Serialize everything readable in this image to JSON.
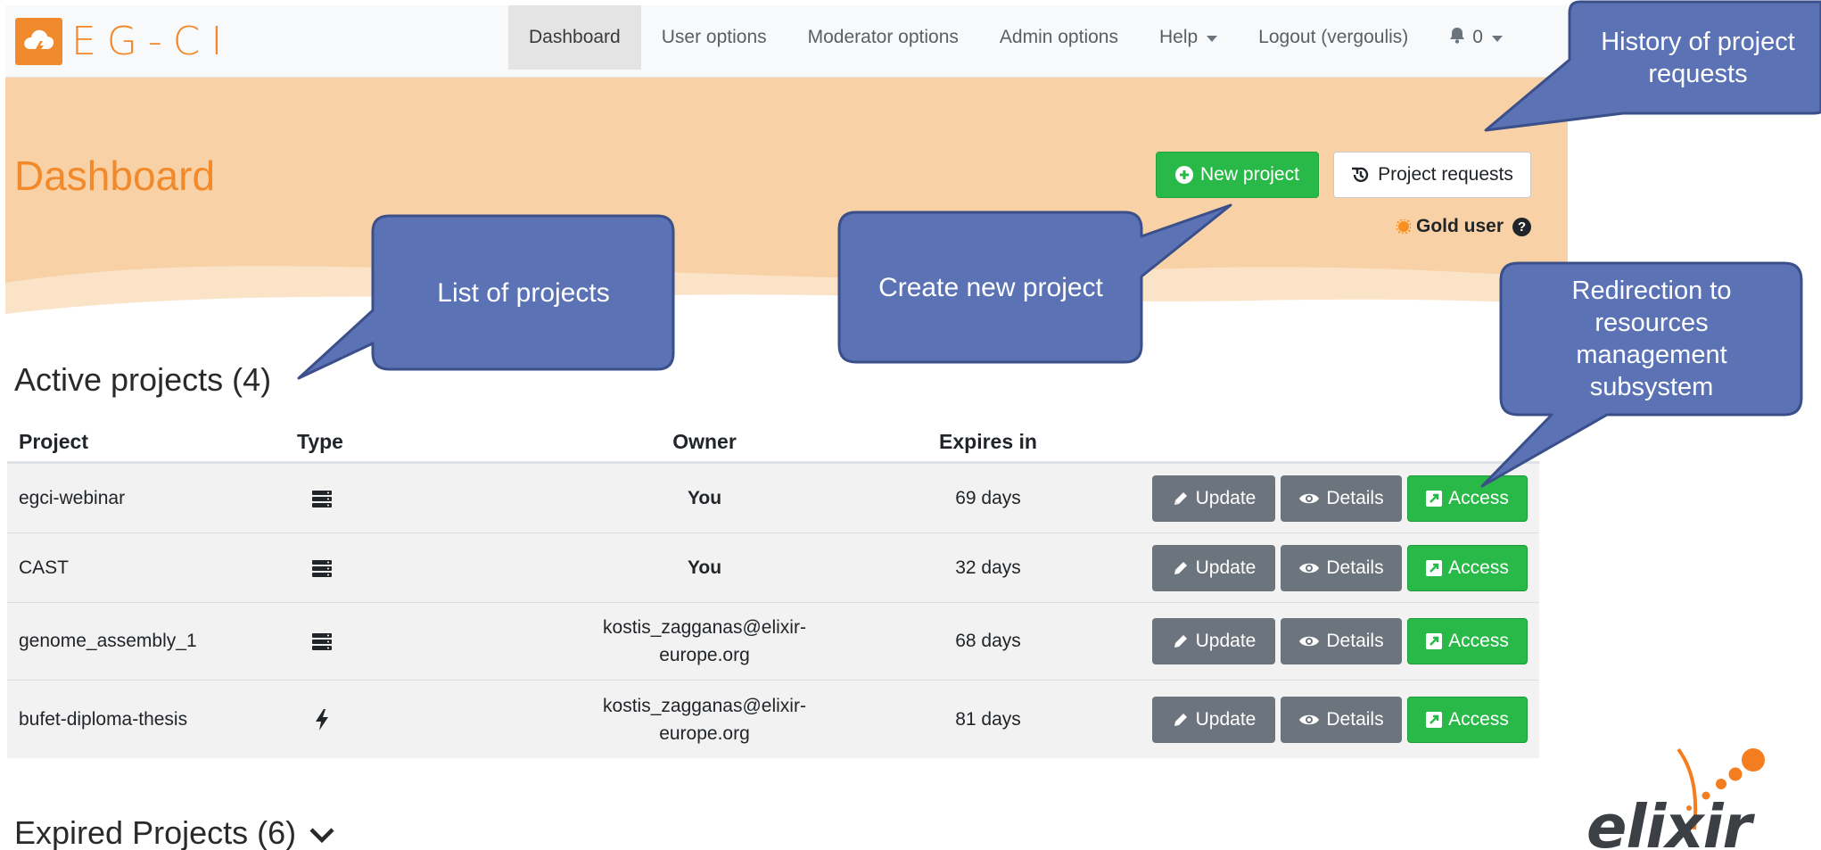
{
  "app": {
    "brand": "EG-CI",
    "colors": {
      "brand": "#f2882a",
      "success": "#28b949",
      "secondary": "#6c757d",
      "callout": "#5b72b5",
      "hero": "#f8d2a6"
    }
  },
  "navbar": {
    "items": [
      {
        "label": "Dashboard",
        "active": true
      },
      {
        "label": "User options"
      },
      {
        "label": "Moderator options"
      },
      {
        "label": "Admin options"
      },
      {
        "label": "Help",
        "dropdown": true
      },
      {
        "label": "Logout (vergoulis)"
      }
    ],
    "notifications": {
      "icon": "bell-icon",
      "count": "0"
    }
  },
  "hero": {
    "title": "Dashboard",
    "new_project_label": "New project",
    "project_requests_label": "Project requests",
    "user_level": "Gold user"
  },
  "active": {
    "title": "Active projects (4)",
    "columns": {
      "project": "Project",
      "type": "Type",
      "owner": "Owner",
      "expires": "Expires in"
    },
    "actions": {
      "update": "Update",
      "details": "Details",
      "access": "Access"
    },
    "rows": [
      {
        "project": "egci-webinar",
        "type_icon": "server-icon",
        "owner": "You",
        "expires": "69 days"
      },
      {
        "project": "CAST",
        "type_icon": "server-icon",
        "owner": "You",
        "expires": "32 days"
      },
      {
        "project": "genome_assembly_1",
        "type_icon": "server-icon",
        "owner_line1": "kostis_zagganas@elixir-",
        "owner_line2": "europe.org",
        "expires": "68 days"
      },
      {
        "project": "bufet-diploma-thesis",
        "type_icon": "bolt-icon",
        "owner_line1": "kostis_zagganas@elixir-",
        "owner_line2": "europe.org",
        "expires": "81 days"
      }
    ]
  },
  "expired": {
    "title": "Expired Projects (6)"
  },
  "callouts": {
    "history": {
      "line1": "History of project",
      "line2": "requests"
    },
    "list": "List of projects",
    "create": "Create new project",
    "redirect": {
      "line1": "Redirection to",
      "line2": "resources",
      "line3": "management",
      "line4": "subsystem"
    }
  },
  "logo": {
    "text": "elixir"
  }
}
